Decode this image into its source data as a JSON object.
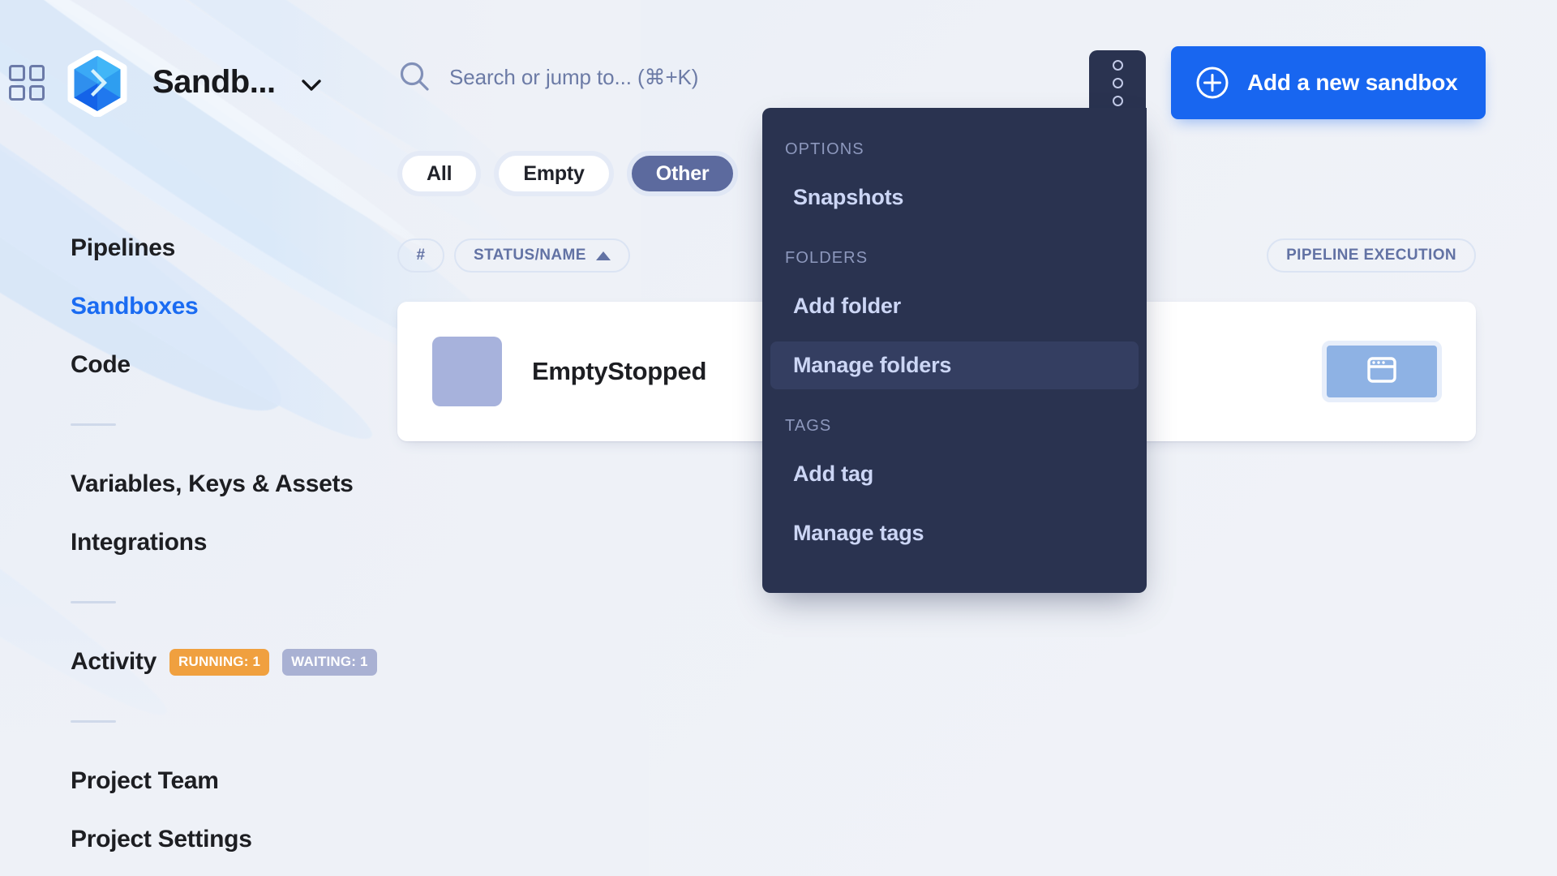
{
  "header": {
    "apps_icon": "grid-apps-icon",
    "brand_title": "Sandb...",
    "brand_caret_icon": "chevron-down-icon",
    "search": {
      "icon": "search-icon",
      "placeholder": "Search or jump to... (⌘+K)",
      "value": ""
    },
    "kebab_button": {
      "icon": "kebab-menu-icon",
      "label": ""
    },
    "add_sandbox": {
      "icon": "plus-circle-icon",
      "label": "Add a new sandbox"
    }
  },
  "sidebar": {
    "items": [
      {
        "label": "Pipelines",
        "active": false
      },
      {
        "label": "Sandboxes",
        "active": true
      },
      {
        "label": "Code",
        "active": false
      },
      {
        "label": "Variables, Keys & Assets",
        "active": false
      },
      {
        "label": "Integrations",
        "active": false
      },
      {
        "label": "Activity",
        "active": false
      },
      {
        "label": "Project Team",
        "active": false
      },
      {
        "label": "Project Settings",
        "active": false
      }
    ],
    "activity_badges": [
      {
        "label": "RUNNING: 1",
        "color": "#f0a03f"
      },
      {
        "label": "WAITING: 1",
        "color": "#a9b1d3"
      }
    ]
  },
  "main": {
    "filters": [
      {
        "label": "All",
        "selected": false
      },
      {
        "label": "Empty",
        "selected": false
      },
      {
        "label": "Other",
        "selected": true
      }
    ],
    "columns": {
      "number": "#",
      "status_name": "STATUS/NAME",
      "sort_direction": "ascending",
      "pipeline_execution": "PIPELINE EXECUTION"
    },
    "rows": [
      {
        "name": "EmptyStopped",
        "thumb_color": "#a7b2dc",
        "action_icon": "browser-window-icon"
      }
    ]
  },
  "menu": {
    "sections": [
      {
        "label": "OPTIONS",
        "items": [
          {
            "label": "Snapshots",
            "highlight": false
          }
        ]
      },
      {
        "label": "FOLDERS",
        "items": [
          {
            "label": "Add folder",
            "highlight": false
          },
          {
            "label": "Manage folders",
            "highlight": true
          }
        ]
      },
      {
        "label": "TAGS",
        "items": [
          {
            "label": "Add tag",
            "highlight": false
          },
          {
            "label": "Manage tags",
            "highlight": false
          }
        ]
      }
    ]
  },
  "colors": {
    "accent_blue": "#1866f0",
    "sidebar_active": "#1a6bf2",
    "menu_bg": "#2a3350",
    "menu_highlight": "#343e61",
    "pill_selected": "#5c6a9e",
    "running_badge": "#f0a03f",
    "waiting_badge": "#a9b1d3",
    "page_bg": "#eef1f7"
  }
}
